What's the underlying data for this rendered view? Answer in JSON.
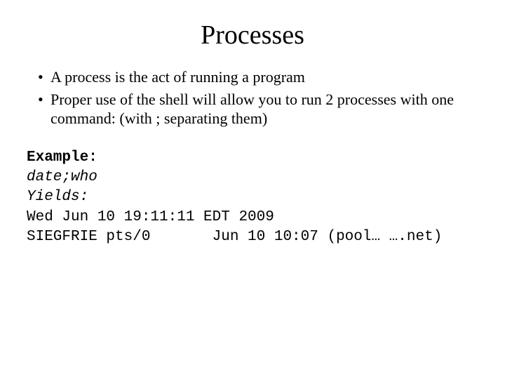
{
  "title": "Processes",
  "bullets": [
    "A process is the act of running a program",
    "Proper use of the shell will allow you to run 2 processes with one command: (with ; separating them)"
  ],
  "example": {
    "label": "Example:",
    "command": "date;who",
    "yields_label": "Yields:",
    "lines": [
      "Wed Jun 10 19:11:11 EDT 2009",
      "SIEGFRIE pts/0       Jun 10 10:07 (pool… ….net)"
    ]
  }
}
